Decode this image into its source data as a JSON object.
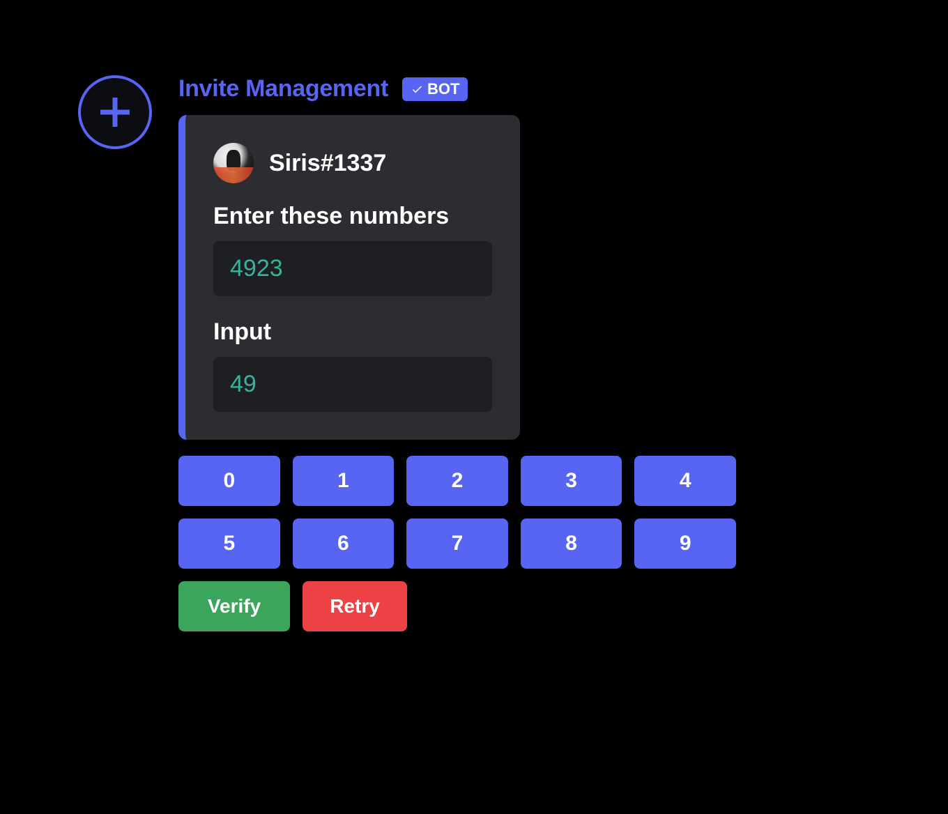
{
  "header": {
    "bot_name": "Invite Management",
    "bot_badge": "BOT"
  },
  "embed": {
    "author": "Siris#1337",
    "fields": {
      "target_label": "Enter these numbers",
      "target_value": "4923",
      "input_label": "Input",
      "input_value": "49"
    }
  },
  "keypad": {
    "row1": [
      "0",
      "1",
      "2",
      "3",
      "4"
    ],
    "row2": [
      "5",
      "6",
      "7",
      "8",
      "9"
    ]
  },
  "actions": {
    "verify": "Verify",
    "retry": "Retry"
  },
  "colors": {
    "accent": "#5865F2",
    "embed_bg": "#2b2d31",
    "field_bg": "#1e1f22",
    "code_text": "#37b39b",
    "verify": "#3BA55C",
    "retry": "#ED4245"
  }
}
